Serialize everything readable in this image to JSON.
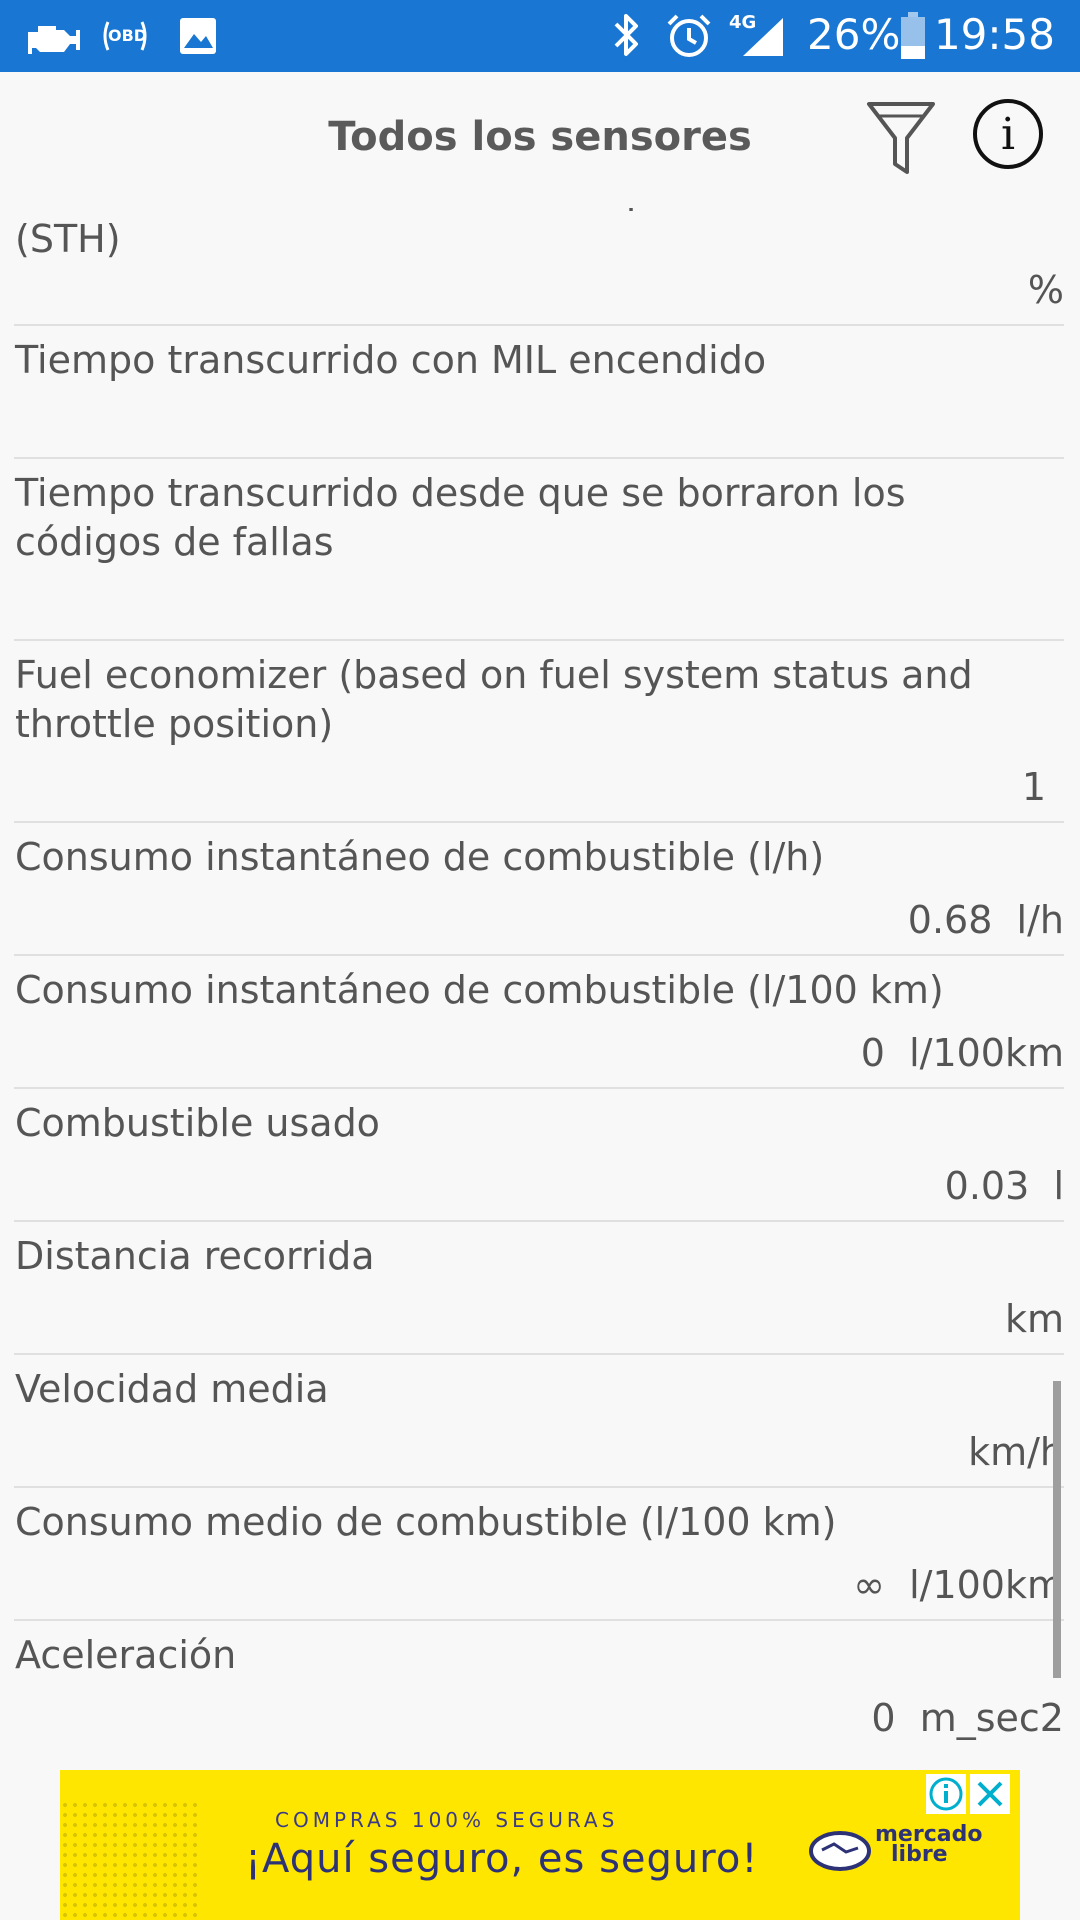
{
  "status_bar": {
    "icons": [
      "check-engine-icon",
      "obd-icon",
      "image-icon",
      "bluetooth-icon",
      "alarm-icon",
      "signal-4g-icon",
      "battery-icon"
    ],
    "network_label": "4G",
    "obd_label": "OBD",
    "battery_percent": "26%",
    "time": "19:58",
    "background_color": "#1976d2"
  },
  "app_bar": {
    "title": "Todos los sensores",
    "filter_icon": "filter-icon",
    "info_icon": "info-icon",
    "info_glyph": "i"
  },
  "sensors": [
    {
      "name": "Actuador comandado de la mariposa de admisión (STH)",
      "value": "%"
    },
    {
      "name": "Tiempo transcurrido con MIL encendido",
      "value": ""
    },
    {
      "name": "Tiempo transcurrido desde que se borraron los códigos de fallas",
      "value": ""
    },
    {
      "name": "Fuel economizer (based on fuel system status and throttle position)",
      "value": "1"
    },
    {
      "name": "Consumo instantáneo de combustible (l/h)",
      "value": "0.68  l/h"
    },
    {
      "name": "Consumo instantáneo de combustible (l/100 km)",
      "value": "0  l/100km"
    },
    {
      "name": "Combustible usado",
      "value": "0.03  l"
    },
    {
      "name": "Distancia recorrida",
      "value": "km"
    },
    {
      "name": "Velocidad media",
      "value": "km/h"
    },
    {
      "name": "Consumo medio de combustible (l/100 km)",
      "value": "∞  l/100km"
    },
    {
      "name": "Aceleración",
      "value": "0  m_sec2"
    }
  ],
  "ad": {
    "kicker": "COMPRAS 100% SEGURAS",
    "headline": "¡Aquí seguro, es seguro!",
    "logo_line1": "mercado",
    "logo_line2": "libre",
    "background_color": "#ffe600"
  }
}
